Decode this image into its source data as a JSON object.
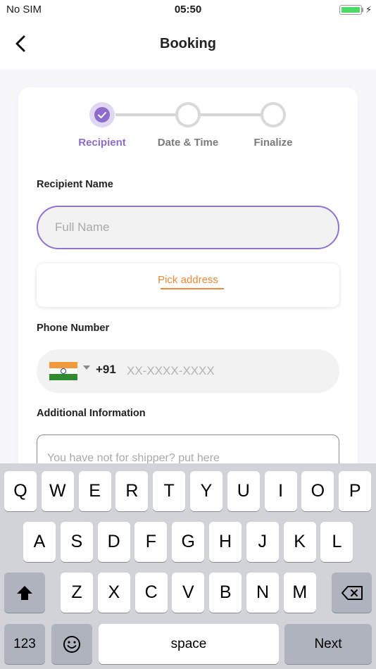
{
  "status_bar": {
    "carrier": "No SIM",
    "time": "05:50",
    "battery_level": 1.0
  },
  "nav": {
    "title": "Booking",
    "back_icon": "chevron-left-icon"
  },
  "stepper": {
    "steps": [
      {
        "label": "Recipient",
        "state": "active"
      },
      {
        "label": "Date & Time",
        "state": "pending"
      },
      {
        "label": "Finalize",
        "state": "pending"
      }
    ],
    "accent_color": "#8e6ccb"
  },
  "form": {
    "recipient_label": "Recipient Name",
    "name_placeholder": "Full Name",
    "pick_address_label": "Pick address",
    "phone_label": "Phone Number",
    "flag_icon": "india-flag-icon",
    "dial_code": "+91",
    "phone_placeholder": "XX-XXXX-XXXX",
    "additional_label": "Additional Information",
    "additional_placeholder": "You have not for shipper? put here"
  },
  "colors": {
    "accent": "#8e6ccb",
    "link": "#ec8a3b"
  },
  "keyboard": {
    "row1": [
      "Q",
      "W",
      "E",
      "R",
      "T",
      "Y",
      "U",
      "I",
      "O",
      "P"
    ],
    "row2": [
      "A",
      "S",
      "D",
      "F",
      "G",
      "H",
      "J",
      "K",
      "L"
    ],
    "row3": [
      "Z",
      "X",
      "C",
      "V",
      "B",
      "N",
      "M"
    ],
    "shift_icon": "shift-icon",
    "backspace_icon": "backspace-icon",
    "numbers_label": "123",
    "emoji_icon": "emoji-icon",
    "space_label": "space",
    "next_label": "Next"
  }
}
